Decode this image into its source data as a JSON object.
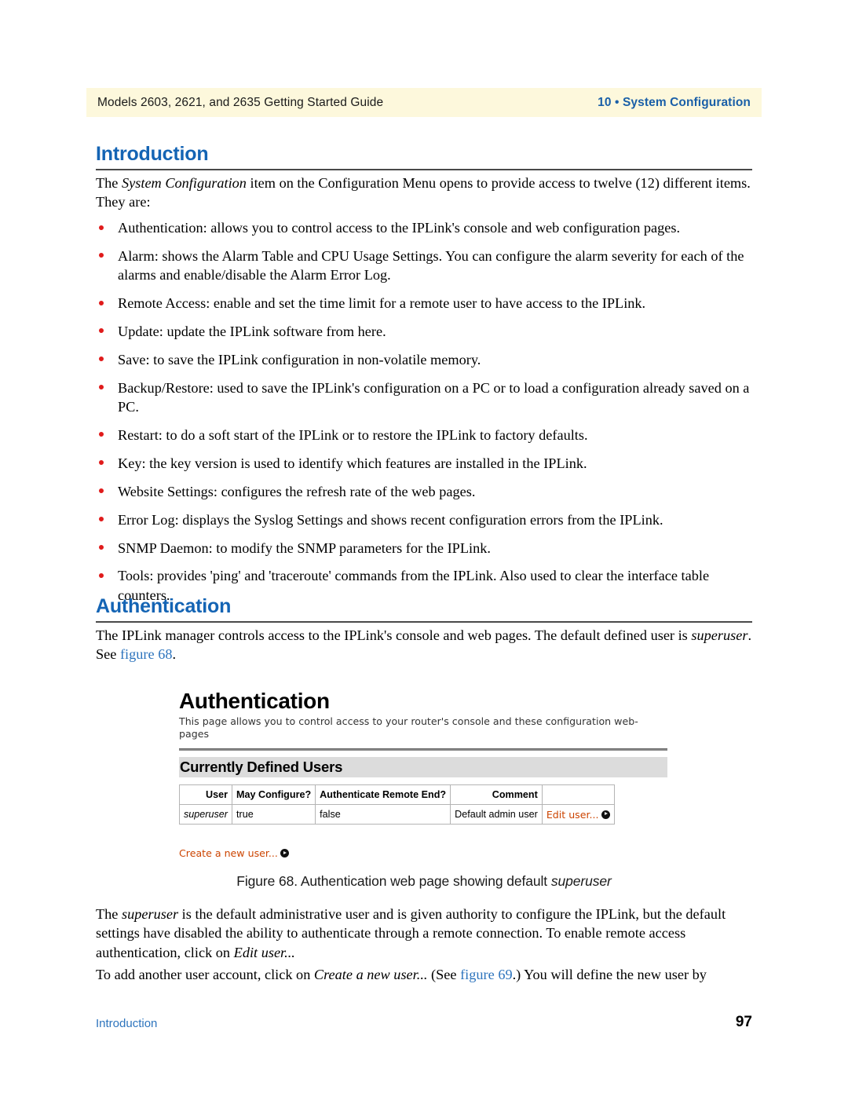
{
  "header": {
    "left": "Models 2603, 2621, and 2635 Getting Started Guide",
    "right": "10 • System Configuration",
    "band_color": "#fdf8dc",
    "right_color": "#1a5fa8"
  },
  "sections": {
    "introduction": {
      "heading": "Introduction",
      "intro_before": "The ",
      "intro_italic": "System Configuration",
      "intro_after": " item on the Configuration Menu opens to provide access to twelve (12) different items. They are:",
      "bullets": [
        "Authentication: allows you to control access to the IPLink's console and web configuration pages.",
        "Alarm: shows the Alarm Table and CPU Usage Settings. You can configure the alarm severity for each of the alarms and enable/disable the Alarm Error Log.",
        "Remote Access: enable and set the time limit for a remote user to have access to the IPLink.",
        "Update: update the IPLink software from here.",
        "Save: to save the IPLink configuration in non-volatile memory.",
        "Backup/Restore: used to save the IPLink's configuration on a PC or to load a configuration already saved on a PC.",
        "Restart: to do a soft start of the IPLink or to restore the IPLink to factory defaults.",
        "Key: the key version is used to identify which features are installed in the IPLink.",
        "Website Settings: configures the refresh rate of the web pages.",
        "Error Log: displays the Syslog Settings and shows recent configuration errors from the IPLink.",
        "SNMP Daemon: to modify the SNMP parameters for the IPLink.",
        "Tools: provides 'ping' and 'traceroute' commands from the IPLink. Also used to clear the interface table counters."
      ]
    },
    "authentication": {
      "heading": "Authentication",
      "para1_a": "The IPLink manager controls access to the IPLink's console and web pages. The default defined user is ",
      "para1_italic": "superuser",
      "para1_b": ". See ",
      "para1_link": "figure 68",
      "para1_c": "."
    }
  },
  "figure": {
    "caption_before": "Figure 68. Authentication web page showing default ",
    "caption_italic": "superuser",
    "screenshot": {
      "title": "Authentication",
      "subtitle": "This page allows you to control access to your router's console and these configuration web-pages",
      "section_band": "Currently Defined Users",
      "band_color": "#dcdcdc",
      "link_color": "#cc4400",
      "table": {
        "columns": [
          "User",
          "May Configure?",
          "Authenticate Remote End?",
          "Comment",
          ""
        ],
        "rows": [
          {
            "user": "superuser",
            "may_configure": "true",
            "authenticate_remote_end": "false",
            "comment": "Default admin user",
            "action": "Edit user...",
            "action_icon": "circle-arrow-icon"
          }
        ]
      },
      "create_link": "Create a new user...",
      "create_link_icon": "circle-arrow-icon"
    }
  },
  "closing": {
    "para2_a": "The ",
    "para2_i1": "superuser",
    "para2_b": " is the default administrative user and is given authority to configure the IPLink, but the default settings have disabled the ability to authenticate through a remote connection. To enable remote access authentication, click on ",
    "para2_i2": "Edit user...",
    "para3_a": "To add another user account, click on ",
    "para3_i1": "Create a new user...",
    "para3_b": " (See ",
    "para3_link": "figure 69",
    "para3_c": ".) You will define the new user by"
  },
  "footer": {
    "left": "Introduction",
    "page_number": "97",
    "left_color": "#2d74bd"
  }
}
